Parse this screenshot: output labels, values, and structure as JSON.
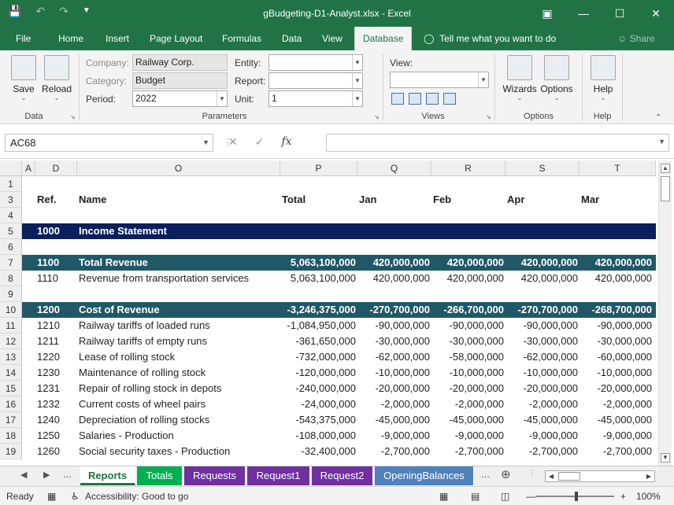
{
  "window": {
    "title": "gBudgeting-D1-Analyst.xlsx  -  Excel",
    "controls": [
      "restore-ribbon",
      "minimize",
      "maximize",
      "close"
    ]
  },
  "ribbon_tabs": [
    {
      "label": "File"
    },
    {
      "label": "Home"
    },
    {
      "label": "Insert"
    },
    {
      "label": "Page Layout"
    },
    {
      "label": "Formulas"
    },
    {
      "label": "Data"
    },
    {
      "label": "View"
    },
    {
      "label": "Database",
      "active": true
    }
  ],
  "tell_me": "Tell me what you want to do",
  "share": "Share",
  "ribbon": {
    "data_group": {
      "label": "Data",
      "save": "Save",
      "reload": "Reload"
    },
    "parameters_group": {
      "label": "Parameters",
      "company_label": "Company:",
      "company_value": "Railway Corp.",
      "category_label": "Category:",
      "category_value": "Budget",
      "period_label": "Period:",
      "period_value": "2022",
      "entity_label": "Entity:",
      "entity_value": "",
      "report_label": "Report:",
      "report_value": "",
      "unit_label": "Unit:",
      "unit_value": "1"
    },
    "views_group": {
      "label": "Views",
      "view_label": "View:",
      "view_value": ""
    },
    "options_group": {
      "label": "Options",
      "wizards": "Wizards",
      "options": "Options"
    },
    "help_group": {
      "label": "Help",
      "help": "Help"
    }
  },
  "formula_bar": {
    "name_box": "AC68",
    "formula": ""
  },
  "grid": {
    "columns": [
      "A",
      "D",
      "O",
      "P",
      "Q",
      "R",
      "S",
      "T"
    ],
    "header": {
      "ref": "Ref.",
      "name": "Name",
      "total": "Total",
      "jan": "Jan",
      "feb": "Feb",
      "apr": "Apr",
      "mar": "Mar"
    },
    "rows": [
      {
        "n": "1"
      },
      {
        "n": "3",
        "type": "header"
      },
      {
        "n": "4"
      },
      {
        "n": "5",
        "type": "navy",
        "ref": "1000",
        "name": "Income Statement"
      },
      {
        "n": "6"
      },
      {
        "n": "7",
        "type": "teal",
        "ref": "1100",
        "name": "Total Revenue",
        "total": "5,063,100,000",
        "q": "420,000,000",
        "r": "420,000,000",
        "s": "420,000,000",
        "t": "420,000,000"
      },
      {
        "n": "8",
        "ref": "1110",
        "name": "Revenue from transportation services",
        "total": "5,063,100,000",
        "q": "420,000,000",
        "r": "420,000,000",
        "s": "420,000,000",
        "t": "420,000,000"
      },
      {
        "n": "9"
      },
      {
        "n": "10",
        "type": "teal",
        "ref": "1200",
        "name": "Cost of Revenue",
        "total": "-3,246,375,000",
        "q": "-270,700,000",
        "r": "-266,700,000",
        "s": "-270,700,000",
        "t": "-268,700,000"
      },
      {
        "n": "11",
        "ref": "1210",
        "name": "Railway tariffs of loaded runs",
        "total": "-1,084,950,000",
        "q": "-90,000,000",
        "r": "-90,000,000",
        "s": "-90,000,000",
        "t": "-90,000,000"
      },
      {
        "n": "12",
        "ref": "1211",
        "name": "Railway tariffs of empty runs",
        "total": "-361,650,000",
        "q": "-30,000,000",
        "r": "-30,000,000",
        "s": "-30,000,000",
        "t": "-30,000,000"
      },
      {
        "n": "13",
        "ref": "1220",
        "name": "Lease of rolling stock",
        "total": "-732,000,000",
        "q": "-62,000,000",
        "r": "-58,000,000",
        "s": "-62,000,000",
        "t": "-60,000,000"
      },
      {
        "n": "14",
        "ref": "1230",
        "name": "Maintenance of rolling stock",
        "total": "-120,000,000",
        "q": "-10,000,000",
        "r": "-10,000,000",
        "s": "-10,000,000",
        "t": "-10,000,000"
      },
      {
        "n": "15",
        "ref": "1231",
        "name": "Repair of rolling stock in depots",
        "total": "-240,000,000",
        "q": "-20,000,000",
        "r": "-20,000,000",
        "s": "-20,000,000",
        "t": "-20,000,000"
      },
      {
        "n": "16",
        "ref": "1232",
        "name": "Current costs of wheel pairs",
        "total": "-24,000,000",
        "q": "-2,000,000",
        "r": "-2,000,000",
        "s": "-2,000,000",
        "t": "-2,000,000"
      },
      {
        "n": "17",
        "ref": "1240",
        "name": "Depreciation of rolling stocks",
        "total": "-543,375,000",
        "q": "-45,000,000",
        "r": "-45,000,000",
        "s": "-45,000,000",
        "t": "-45,000,000"
      },
      {
        "n": "18",
        "ref": "1250",
        "name": "Salaries - Production",
        "total": "-108,000,000",
        "q": "-9,000,000",
        "r": "-9,000,000",
        "s": "-9,000,000",
        "t": "-9,000,000"
      },
      {
        "n": "19",
        "ref": "1260",
        "name": "Social security taxes - Production",
        "total": "-32,400,000",
        "q": "-2,700,000",
        "r": "-2,700,000",
        "s": "-2,700,000",
        "t": "-2,700,000"
      }
    ]
  },
  "sheet_tabs": [
    {
      "label": "Reports",
      "active": true,
      "color": "#ffffff"
    },
    {
      "label": "Totals",
      "color": "#00b050"
    },
    {
      "label": "Requests",
      "color": "#7030a0"
    },
    {
      "label": "Request1",
      "color": "#7030a0"
    },
    {
      "label": "Request2",
      "color": "#7030a0"
    },
    {
      "label": "OpeningBalances",
      "color": "#4f81bd"
    }
  ],
  "status": {
    "ready": "Ready",
    "accessibility": "Accessibility: Good to go",
    "zoom": "100%"
  },
  "colors": {
    "accent": "#217346",
    "band_navy": "#0a1f5c",
    "band_teal": "#215867"
  }
}
